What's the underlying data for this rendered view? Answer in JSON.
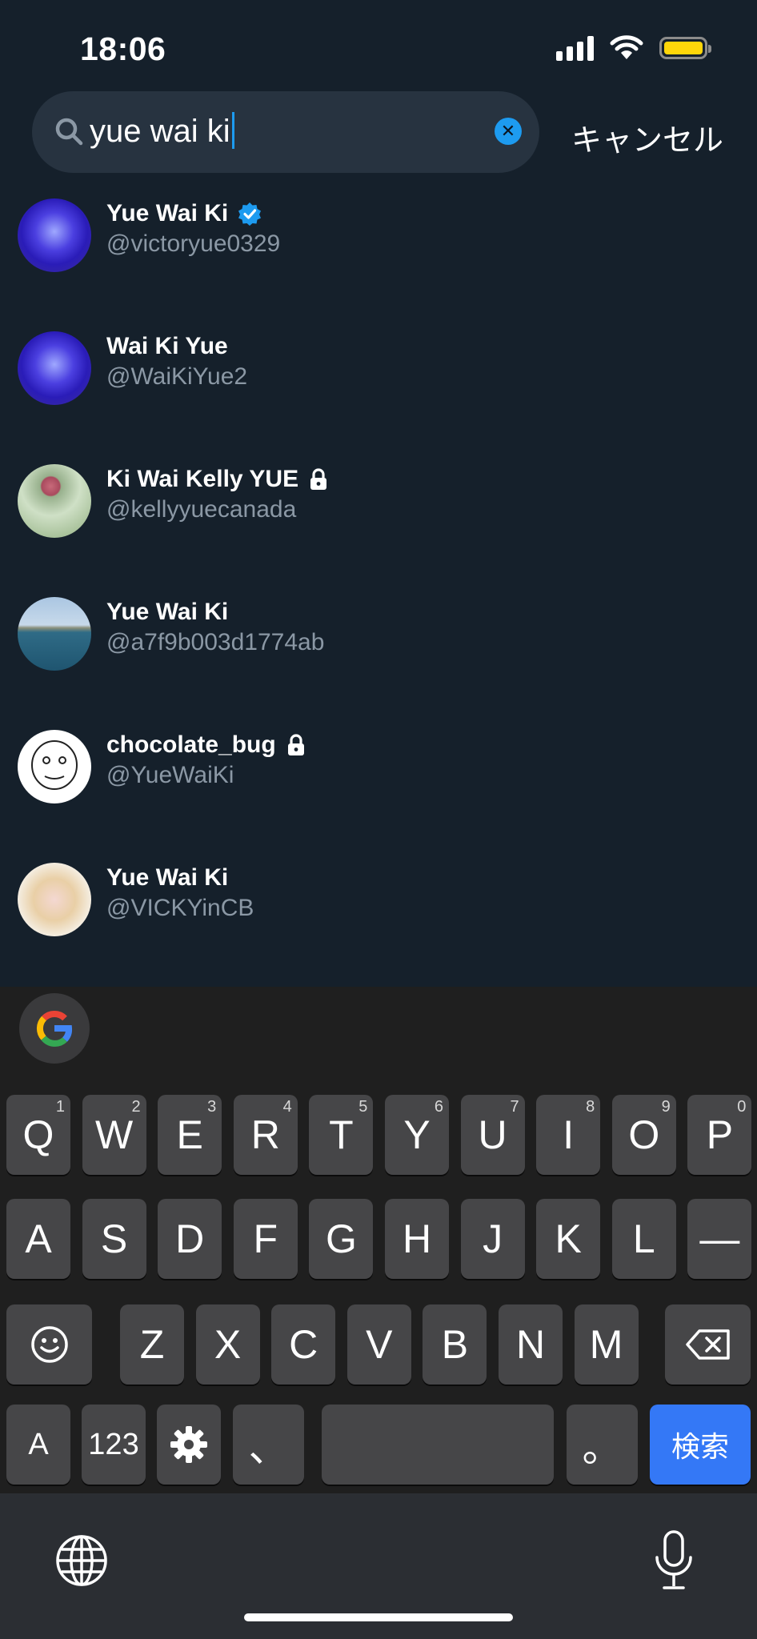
{
  "status": {
    "time": "18:06"
  },
  "search": {
    "query": "yue wai ki",
    "cancel_label": "キャンセル"
  },
  "results": [
    {
      "name": "Yue Wai Ki",
      "handle": "@victoryue0329",
      "badge": "verified-icon"
    },
    {
      "name": "Wai Ki Yue",
      "handle": "@WaiKiYue2",
      "badge": ""
    },
    {
      "name": "Ki Wai Kelly YUE",
      "handle": "@kellyyuecanada",
      "badge": "lock-icon"
    },
    {
      "name": "Yue Wai Ki",
      "handle": "@a7f9b003d1774ab",
      "badge": ""
    },
    {
      "name": "chocolate_bug",
      "handle": "@YueWaiKi",
      "badge": "lock-icon"
    },
    {
      "name": "Yue Wai Ki",
      "handle": "@VICKYinCB",
      "badge": ""
    }
  ],
  "keyboard": {
    "row1": [
      {
        "label": "Q",
        "hint": "1"
      },
      {
        "label": "W",
        "hint": "2"
      },
      {
        "label": "E",
        "hint": "3"
      },
      {
        "label": "R",
        "hint": "4"
      },
      {
        "label": "T",
        "hint": "5"
      },
      {
        "label": "Y",
        "hint": "6"
      },
      {
        "label": "U",
        "hint": "7"
      },
      {
        "label": "I",
        "hint": "8"
      },
      {
        "label": "O",
        "hint": "9"
      },
      {
        "label": "P",
        "hint": "0"
      }
    ],
    "row2": [
      "A",
      "S",
      "D",
      "F",
      "G",
      "H",
      "J",
      "K",
      "L",
      "—"
    ],
    "row3": [
      "Z",
      "X",
      "C",
      "V",
      "B",
      "N",
      "M"
    ],
    "row4": {
      "abc": "A",
      "num": "123",
      "comma": "、",
      "period": "。",
      "search": "検索"
    }
  },
  "colors": {
    "background": "#15202b",
    "accent": "#1d9bf0",
    "search_key": "#3478f6",
    "battery": "#ffd60a"
  }
}
